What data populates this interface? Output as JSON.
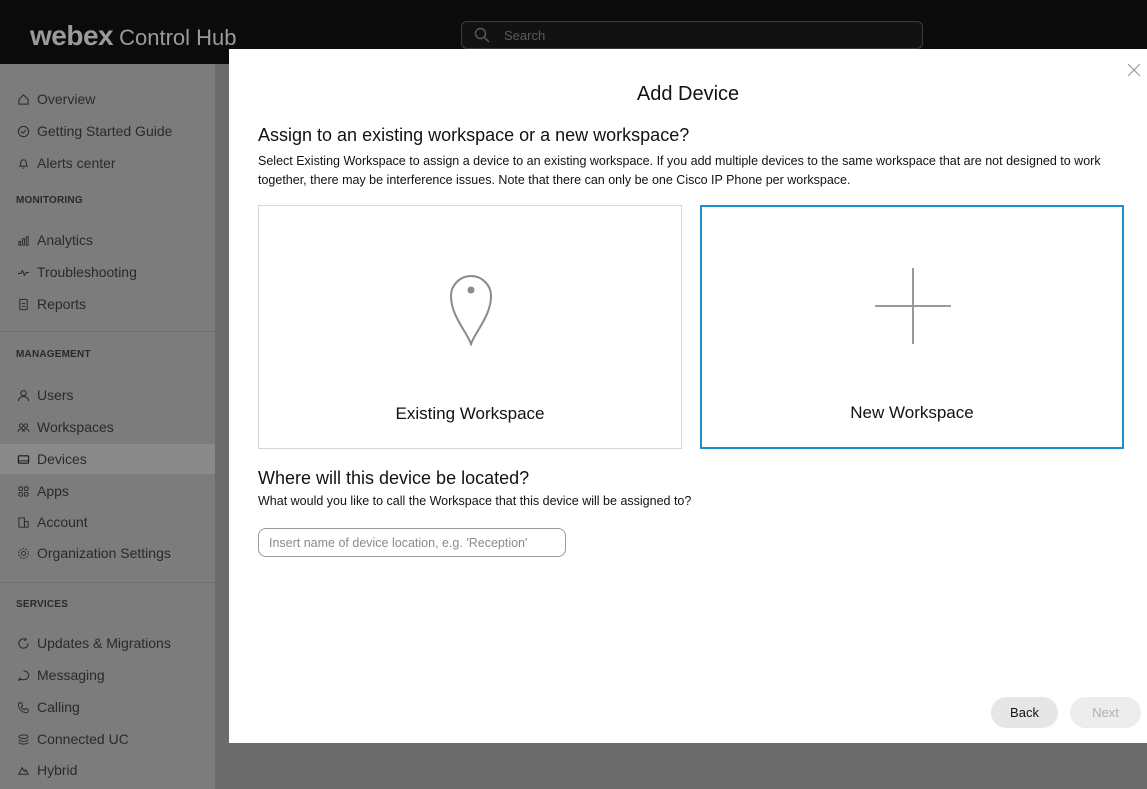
{
  "app": {
    "logo": "webex",
    "product": "Control Hub"
  },
  "search": {
    "placeholder": "Search"
  },
  "sidebar": {
    "top_items": [
      {
        "label": "Overview",
        "icon": "home-icon"
      },
      {
        "label": "Getting Started Guide",
        "icon": "check-circle-icon"
      },
      {
        "label": "Alerts center",
        "icon": "bell-icon"
      }
    ],
    "sections": {
      "monitoring": "MONITORING",
      "management": "MANAGEMENT",
      "services": "SERVICES"
    },
    "monitoring_items": [
      {
        "label": "Analytics",
        "icon": "bar-chart-icon"
      },
      {
        "label": "Troubleshooting",
        "icon": "pulse-icon"
      },
      {
        "label": "Reports",
        "icon": "document-icon"
      }
    ],
    "management_items": [
      {
        "label": "Users",
        "icon": "user-icon"
      },
      {
        "label": "Workspaces",
        "icon": "people-icon"
      },
      {
        "label": "Devices",
        "icon": "device-icon",
        "active": true
      },
      {
        "label": "Apps",
        "icon": "apps-grid-icon"
      },
      {
        "label": "Account",
        "icon": "building-icon"
      },
      {
        "label": "Organization Settings",
        "icon": "gear-icon"
      }
    ],
    "services_items": [
      {
        "label": "Updates & Migrations",
        "icon": "refresh-icon"
      },
      {
        "label": "Messaging",
        "icon": "chat-bubble-icon"
      },
      {
        "label": "Calling",
        "icon": "phone-icon"
      },
      {
        "label": "Connected UC",
        "icon": "stack-icon"
      },
      {
        "label": "Hybrid",
        "icon": "cloud-icon"
      }
    ]
  },
  "modal": {
    "title": "Add Device",
    "question1": "Assign to an existing workspace or a new workspace?",
    "description": "Select Existing Workspace to assign a device to an existing workspace. If you add multiple devices to the same workspace that are not designed to work together, there may be interference issues. Note that there can only be one Cisco IP Phone per workspace.",
    "option_existing": "Existing Workspace",
    "option_new": "New Workspace",
    "selected_option": "New Workspace",
    "question2": "Where will this device be located?",
    "description2": "What would you like to call the Workspace that this device will be assigned to?",
    "location_placeholder": "Insert name of device location, e.g. 'Reception'",
    "location_value": "",
    "back_label": "Back",
    "next_label": "Next"
  },
  "colors": {
    "accent": "#1c8fc9",
    "topbar": "#0b0b0b",
    "overlay": "#7c7c7c"
  }
}
